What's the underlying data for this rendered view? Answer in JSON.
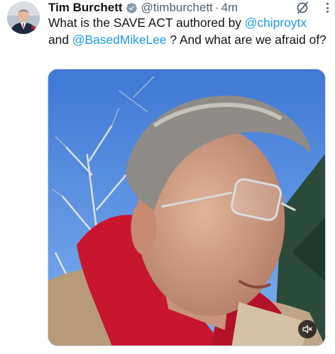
{
  "tweet": {
    "author": {
      "name": "Tim Burchett",
      "handle": "@timburchett",
      "verified": true,
      "verified_color": "#829aab"
    },
    "separator": "·",
    "timestamp": "4m",
    "text": {
      "part1": "What is the SAVE ACT authored by ",
      "mention1": "@chiproytx",
      "part2": " and ",
      "mention2": "@BasedMikeLee",
      "part3": " ? And what are we afraid of?"
    },
    "media": {
      "type": "video",
      "muted": true
    }
  },
  "icons": {
    "grok": "grok-icon",
    "more": "more-icon",
    "mute": "speaker-muted-icon"
  },
  "colors": {
    "text": "#0f1419",
    "secondary": "#536471",
    "link": "#1d9bf0"
  }
}
